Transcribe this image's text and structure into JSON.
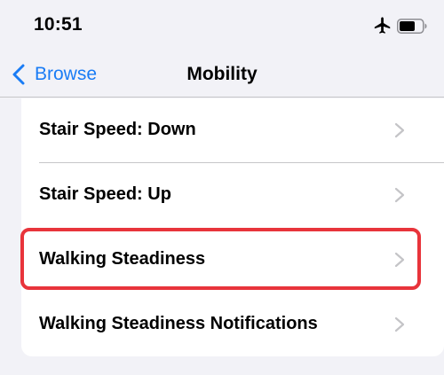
{
  "status_bar": {
    "time": "10:51",
    "icons": [
      "airplane-icon",
      "battery-icon"
    ]
  },
  "nav_bar": {
    "back_label": "Browse",
    "back_icon": "chevron-left-icon",
    "title": "Mobility"
  },
  "list": {
    "items": [
      {
        "label": "Stair Speed: Down",
        "icon": "chevron-right-icon"
      },
      {
        "label": "Stair Speed: Up",
        "icon": "chevron-right-icon"
      },
      {
        "label": "Walking Steadiness",
        "icon": "chevron-right-icon",
        "highlighted": true
      },
      {
        "label": "Walking Steadiness Notifications",
        "icon": "chevron-right-icon"
      }
    ]
  },
  "colors": {
    "accent": "#1a7cf5",
    "background": "#f2f2f7",
    "highlight": "#e8343b",
    "chevron": "#c4c4c7"
  }
}
